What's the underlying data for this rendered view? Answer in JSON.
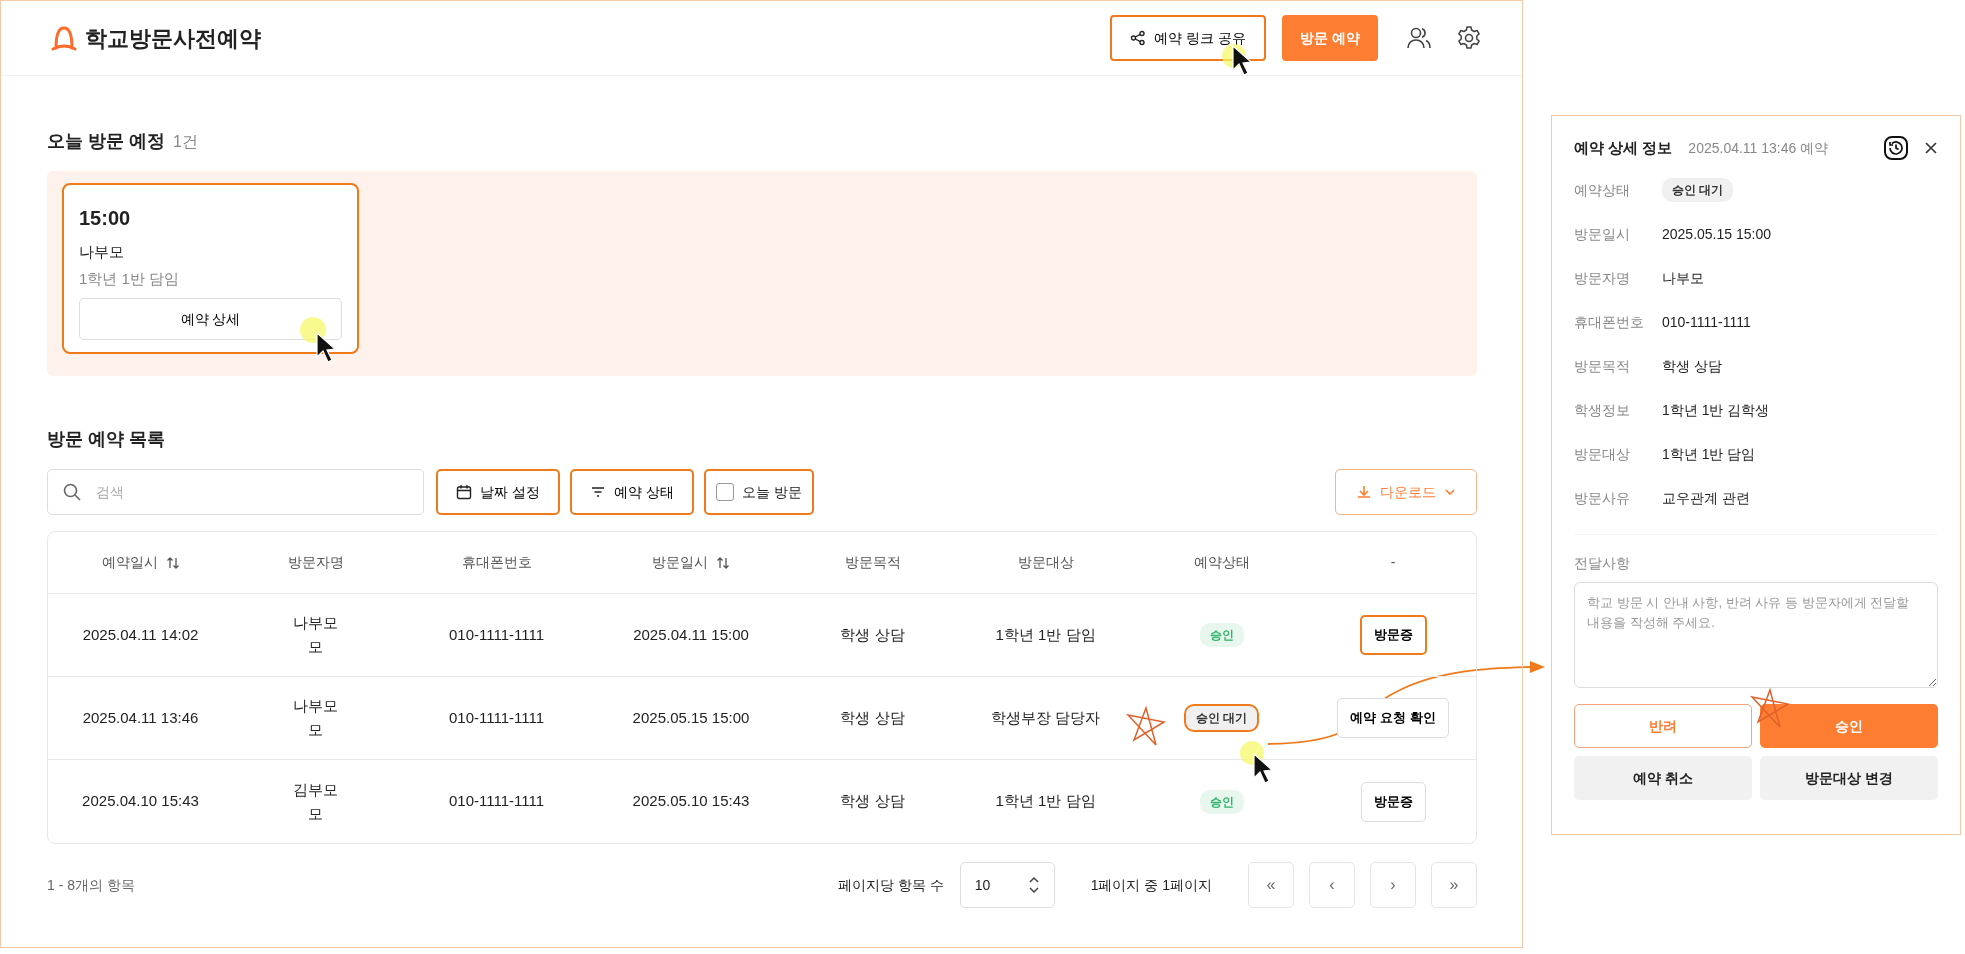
{
  "app": {
    "title": "학교방문사전예약"
  },
  "header_actions": [
    {
      "kind": "share",
      "label": "예약 링크 공유",
      "highlighted": true
    },
    {
      "kind": "primary",
      "label": "방문 예약",
      "highlighted": false
    }
  ],
  "today": {
    "title": "오늘 방문 예정",
    "count": "1건",
    "cards": [
      {
        "time": "15:00",
        "visitor": "나부모",
        "target": "1학년 1반 담임",
        "button": "예약 상세",
        "highlighted": true
      }
    ]
  },
  "list": {
    "title": "방문 예약 목록",
    "search": {
      "placeholder": "검색"
    },
    "filters": [
      {
        "kind": "date",
        "label": "날짜 설정",
        "highlighted": true
      },
      {
        "kind": "filter",
        "label": "예약 상태",
        "highlighted": true
      },
      {
        "kind": "checkbox",
        "label": "오늘 방문",
        "checked": false,
        "highlighted": true
      }
    ],
    "download": "다운로드"
  },
  "table": {
    "columns": [
      {
        "label": "예약일시",
        "sortable": true
      },
      {
        "label": "방문자명",
        "sortable": false
      },
      {
        "label": "휴대폰번호",
        "sortable": false
      },
      {
        "label": "방문일시",
        "sortable": true
      },
      {
        "label": "방문목적",
        "sortable": false
      },
      {
        "label": "방문대상",
        "sortable": false
      },
      {
        "label": "예약상태",
        "sortable": false
      },
      {
        "label": "-",
        "sortable": false
      }
    ],
    "rows": [
      {
        "cells": [
          "2025.04.11 14:02",
          "나부모 모",
          "010-1111-1111",
          "2025.04.11 15:00",
          "학생 상담",
          "1학년 1반 담임"
        ],
        "status": {
          "kind": "approved",
          "label": "승인",
          "highlighted": false
        },
        "action": {
          "label": "방문증",
          "highlighted": true
        }
      },
      {
        "cells": [
          "2025.04.11 13:46",
          "나부모 모",
          "010-1111-1111",
          "2025.05.15 15:00",
          "학생 상담",
          "학생부장 담당자"
        ],
        "status": {
          "kind": "pending",
          "label": "승인 대기",
          "highlighted": true
        },
        "action": {
          "label": "예약 요청 확인",
          "highlighted": false
        }
      },
      {
        "cells": [
          "2025.04.10 15:43",
          "김부모 모",
          "010-1111-1111",
          "2025.05.10 15:43",
          "학생 상담",
          "1학년 1반 담임"
        ],
        "status": {
          "kind": "approved",
          "label": "승인",
          "highlighted": false
        },
        "action": {
          "label": "방문증",
          "highlighted": false
        }
      }
    ]
  },
  "pagination": {
    "summary": "1 - 8개의 항목",
    "per_page_label": "페이지당 항목 수",
    "per_page": "10",
    "page_info": "1페이지 중 1페이지",
    "buttons": [
      "«",
      "‹",
      "›",
      "»"
    ]
  },
  "detail": {
    "title": "예약 상세 정보",
    "subtitle": "2025.04.11 13:46 예약",
    "fields": [
      {
        "kind": "badge",
        "label": "예약상태",
        "value": "승인 대기"
      },
      {
        "kind": "text",
        "label": "방문일시",
        "value": "2025.05.15 15:00"
      },
      {
        "kind": "text",
        "label": "방문자명",
        "value": "나부모"
      },
      {
        "kind": "text",
        "label": "휴대폰번호",
        "value": "010-1111-1111"
      },
      {
        "kind": "text",
        "label": "방문목적",
        "value": "학생 상담"
      },
      {
        "kind": "text",
        "label": "학생정보",
        "value": "1학년 1반 김학생"
      },
      {
        "kind": "text",
        "label": "방문대상",
        "value": "1학년 1반 담임"
      },
      {
        "kind": "text",
        "label": "방문사유",
        "value": "교우관계 관련"
      }
    ],
    "message": {
      "label": "전달사항",
      "placeholder": "학교 방문 시 안내 사항, 반려 사유 등 방문자에게 전달할 내용을 작성해 주세요."
    },
    "buttons": [
      {
        "kind": "reject",
        "label": "반려"
      },
      {
        "kind": "approve",
        "label": "승인"
      },
      {
        "kind": "muted",
        "label": "예약 취소"
      },
      {
        "kind": "muted",
        "label": "방문대상 변경"
      }
    ]
  }
}
